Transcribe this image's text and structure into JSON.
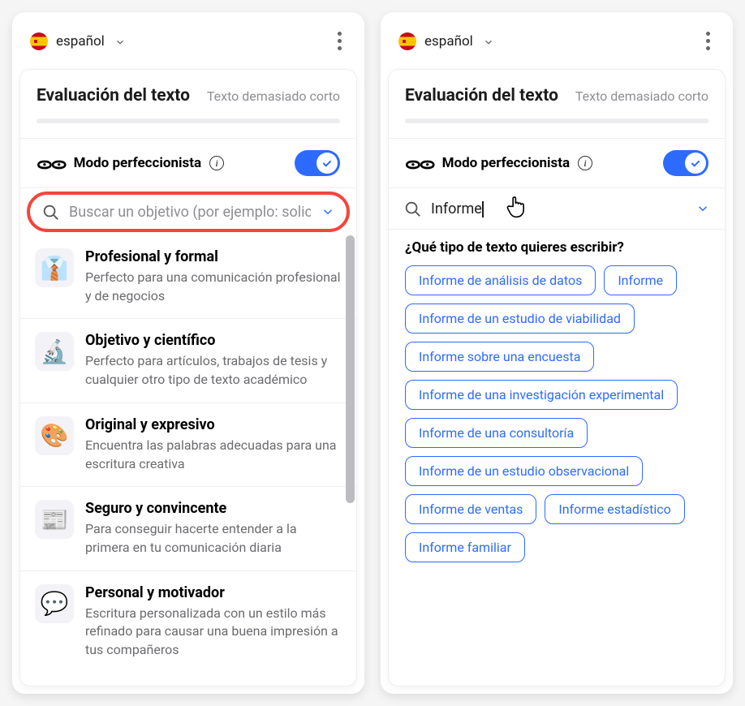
{
  "left": {
    "language": "español",
    "eval": {
      "title": "Evaluación del texto",
      "status": "Texto demasiado corto"
    },
    "mode": {
      "label": "Modo perfeccionista",
      "on": true
    },
    "search": {
      "placeholder": "Buscar un objetivo (por ejemplo: solicitar",
      "value": ""
    },
    "goals": [
      {
        "title": "Profesional y formal",
        "desc": "Perfecto para una comunicación profesional y de negocios",
        "emoji": "👔"
      },
      {
        "title": "Objetivo y científico",
        "desc": "Perfecto para artículos, trabajos de tesis y cualquier otro tipo de texto académico",
        "emoji": "🔬"
      },
      {
        "title": "Original y expresivo",
        "desc": "Encuentra las palabras adecuadas para una escritura creativa",
        "emoji": "🎨"
      },
      {
        "title": "Seguro y convincente",
        "desc": "Para conseguir hacerte entender a la primera en tu comunicación diaria",
        "emoji": "📰"
      },
      {
        "title": "Personal y motivador",
        "desc": "Escritura personalizada con un estilo más refinado para causar una buena impresión a tus compañeros",
        "emoji": "💬"
      }
    ]
  },
  "right": {
    "language": "español",
    "eval": {
      "title": "Evaluación del texto",
      "status": "Texto demasiado corto"
    },
    "mode": {
      "label": "Modo perfeccionista",
      "on": true
    },
    "search": {
      "value": "Informe"
    },
    "prompt_title": "¿Qué tipo de texto quieres escribir?",
    "chips": [
      "Informe de análisis de datos",
      "Informe",
      "Informe de un estudio de viabilidad",
      "Informe sobre una encuesta",
      "Informe de una investigación experimental",
      "Informe de una consultoría",
      "Informe de un estudio observacional",
      "Informe de ventas",
      "Informe estadístico",
      "Informe familiar"
    ]
  }
}
